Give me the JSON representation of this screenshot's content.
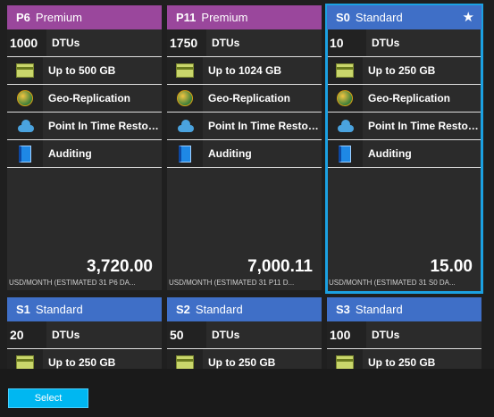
{
  "tiles": [
    {
      "tier": "P6",
      "edition": "Premium",
      "dtus": "1000",
      "dtu_label": "DTUs",
      "storage": "Up to 500 GB",
      "geo": "Geo-Replication",
      "restore": "Point In Time Restore ...",
      "auditing": "Auditing",
      "price": "3,720.00",
      "estimate": "USD/MONTH (ESTIMATED 31 P6 DA..."
    },
    {
      "tier": "P11",
      "edition": "Premium",
      "dtus": "1750",
      "dtu_label": "DTUs",
      "storage": "Up to 1024 GB",
      "geo": "Geo-Replication",
      "restore": "Point In Time Restore ...",
      "auditing": "Auditing",
      "price": "7,000.11",
      "estimate": "USD/MONTH (ESTIMATED 31 P11 D..."
    },
    {
      "tier": "S0",
      "edition": "Standard",
      "dtus": "10",
      "dtu_label": "DTUs",
      "storage": "Up to 250 GB",
      "geo": "Geo-Replication",
      "restore": "Point In Time Restore ...",
      "auditing": "Auditing",
      "price": "15.00",
      "estimate": "USD/MONTH (ESTIMATED 31 S0 DA...",
      "star": "★"
    },
    {
      "tier": "S1",
      "edition": "Standard",
      "dtus": "20",
      "dtu_label": "DTUs",
      "storage": "Up to 250 GB"
    },
    {
      "tier": "S2",
      "edition": "Standard",
      "dtus": "50",
      "dtu_label": "DTUs",
      "storage": "Up to 250 GB"
    },
    {
      "tier": "S3",
      "edition": "Standard",
      "dtus": "100",
      "dtu_label": "DTUs",
      "storage": "Up to 250 GB"
    }
  ],
  "selected_tier": "S0",
  "footer": {
    "select_label": "Select"
  },
  "colors": {
    "premium": "#9a479c",
    "standard": "#3f6fc7",
    "accent": "#00b7f1"
  },
  "icons": [
    "storage-icon",
    "globe-icon",
    "cloud-icon",
    "book-icon",
    "star-icon"
  ]
}
